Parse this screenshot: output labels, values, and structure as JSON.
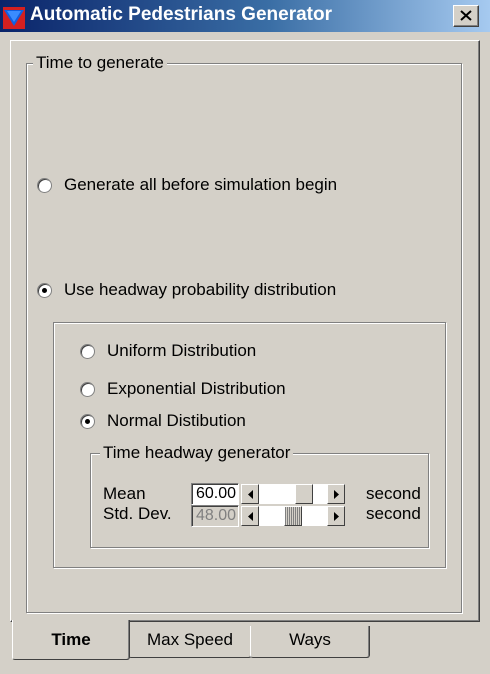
{
  "window": {
    "title": "Automatic Pedestrians Generator",
    "icon": "app-icon",
    "close_icon": "close-icon",
    "accent_color": "#0a246a"
  },
  "time_group": {
    "legend": "Time to generate",
    "generate_all_label": "Generate all before simulation begin",
    "generate_all_selected": false,
    "headway_label": "Use headway probability distribution",
    "headway_selected": true
  },
  "distribution": {
    "uniform_label": "Uniform Distribution",
    "uniform_selected": false,
    "exponential_label": "Exponential Distribution",
    "exponential_selected": false,
    "normal_label": "Normal Distibution",
    "normal_selected": true
  },
  "headway_generator": {
    "legend": "Time headway generator",
    "mean_label": "Mean",
    "mean_value": "60.00",
    "mean_unit": "second",
    "mean_slider_fraction": 0.72,
    "std_label": "Std. Dev.",
    "std_value": "48.00",
    "std_unit": "second",
    "std_slider_fraction": 0.5
  },
  "tabs": [
    {
      "label": "Time",
      "active": true
    },
    {
      "label": "Max Speed",
      "active": false
    },
    {
      "label": "Ways",
      "active": false
    }
  ]
}
